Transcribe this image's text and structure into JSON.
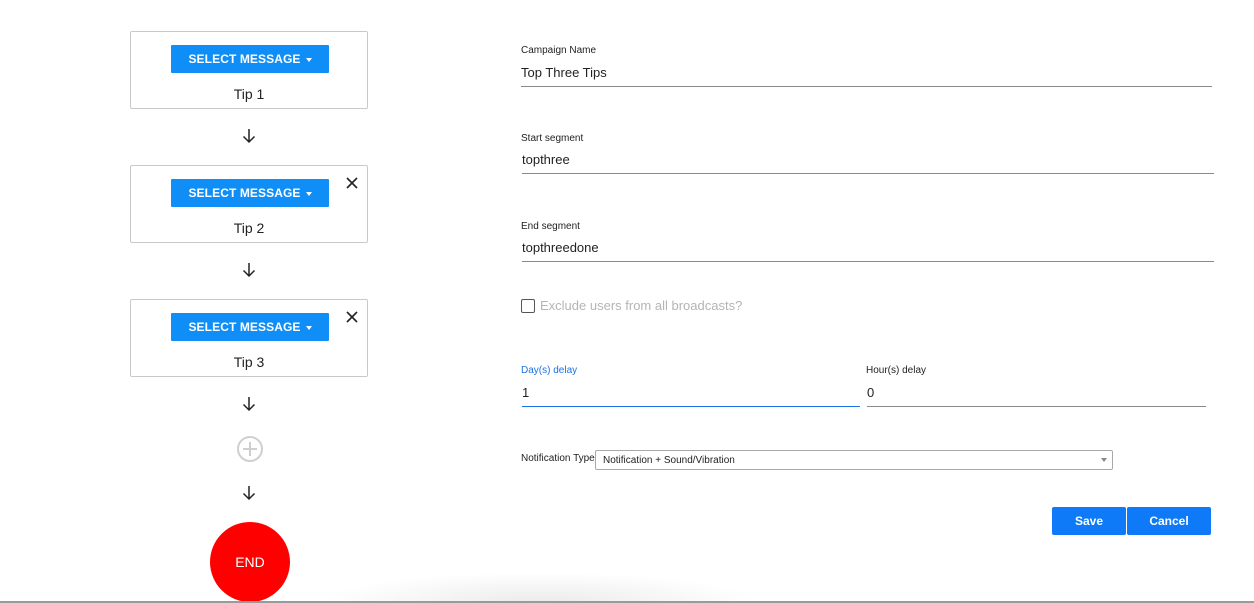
{
  "flow": {
    "steps": [
      {
        "button_label": "SELECT MESSAGE",
        "name": "Tip 1",
        "removable": false
      },
      {
        "button_label": "SELECT MESSAGE",
        "name": "Tip 2",
        "removable": true
      },
      {
        "button_label": "SELECT MESSAGE",
        "name": "Tip 3",
        "removable": true
      }
    ],
    "add_icon": "plus-circle-icon",
    "end_label": "END"
  },
  "form": {
    "campaign_name": {
      "label": "Campaign Name",
      "value": "Top Three Tips"
    },
    "start_segment": {
      "label": "Start segment",
      "value": "topthree"
    },
    "end_segment": {
      "label": "End segment",
      "value": "topthreedone"
    },
    "exclude_checkbox": {
      "label": "Exclude users from all broadcasts?",
      "checked": false,
      "disabled": true
    },
    "days_delay": {
      "label": "Day(s) delay",
      "value": "1",
      "focused": true
    },
    "hours_delay": {
      "label": "Hour(s) delay",
      "value": "0"
    },
    "notification_type": {
      "label": "Notification Type",
      "selected": "Notification + Sound/Vibration"
    },
    "save_label": "Save",
    "cancel_label": "Cancel"
  },
  "colors": {
    "primary_button": "#0f8ef7",
    "end_node": "#ff0000",
    "focus_accent": "#1a73e8"
  }
}
